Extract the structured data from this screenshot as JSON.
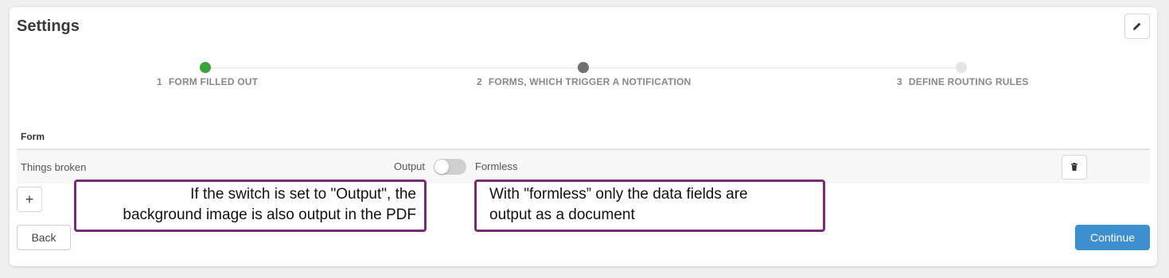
{
  "page": {
    "title": "Settings"
  },
  "stepper": {
    "steps": [
      {
        "number": "1",
        "label": "FORM FILLED OUT",
        "state": "completed",
        "color": "#3aa33a"
      },
      {
        "number": "2",
        "label": "FORMS, WHICH TRIGGER A NOTIFICATION",
        "state": "current",
        "color": "#707070"
      },
      {
        "number": "3",
        "label": "DEFINE ROUTING RULES",
        "state": "upcoming",
        "color": "#e4e4e4"
      }
    ]
  },
  "table": {
    "column_header": "Form",
    "rows": [
      {
        "name": "Things broken",
        "switch_left_label": "Output",
        "switch_right_label": "Formless",
        "switch_state": "off"
      }
    ]
  },
  "icons": {
    "edit": "pencil-icon",
    "delete": "trash-icon",
    "add": "plus-icon"
  },
  "add_button_label": "+",
  "footer": {
    "back_label": "Back",
    "continue_label": "Continue"
  },
  "callouts": [
    {
      "line1": "If the switch is set to \"Output\", the",
      "line2": "background image is also output in the PDF"
    },
    {
      "line1": "With \"formless” only the data fields are",
      "line2": "output as a document"
    }
  ],
  "colors": {
    "accent": "#3d8fce",
    "callout_border": "#7b2b74"
  }
}
